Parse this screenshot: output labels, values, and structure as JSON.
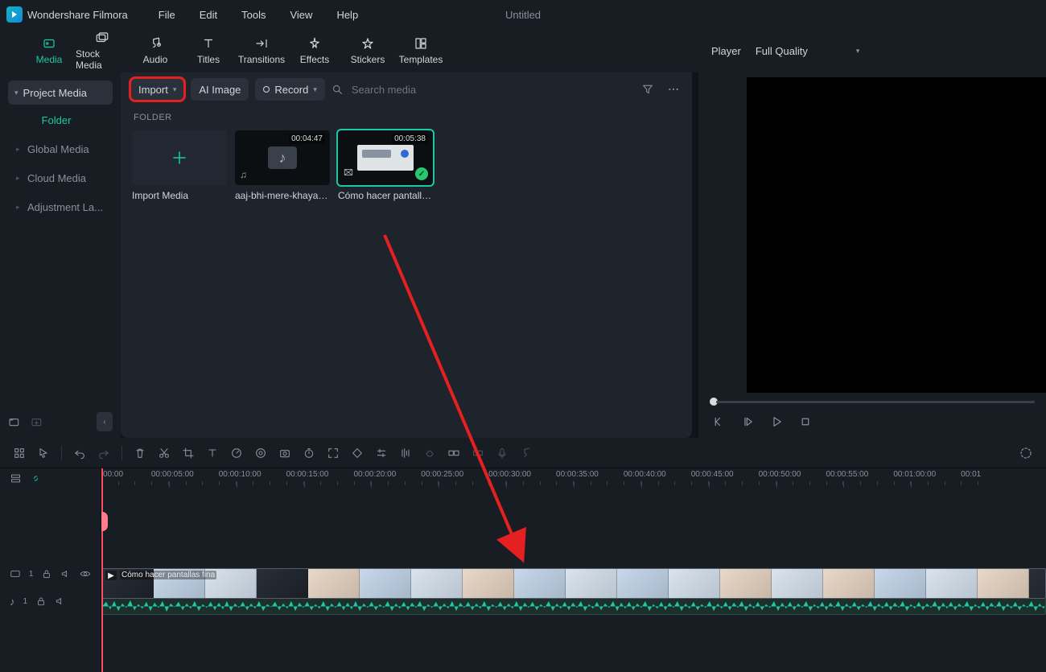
{
  "app": {
    "name": "Wondershare Filmora",
    "doc_title": "Untitled"
  },
  "menu": [
    "File",
    "Edit",
    "Tools",
    "View",
    "Help"
  ],
  "tabs": [
    {
      "label": "Media",
      "active": true
    },
    {
      "label": "Stock Media"
    },
    {
      "label": "Audio"
    },
    {
      "label": "Titles"
    },
    {
      "label": "Transitions"
    },
    {
      "label": "Effects"
    },
    {
      "label": "Stickers"
    },
    {
      "label": "Templates"
    }
  ],
  "sidebar": {
    "header": "Project Media",
    "folder_label": "Folder",
    "items": [
      "Global Media",
      "Cloud Media",
      "Adjustment La..."
    ]
  },
  "mediabar": {
    "import_label": "Import",
    "ai_label": "AI Image",
    "record_label": "Record",
    "search_placeholder": "Search media"
  },
  "folder_header": "FOLDER",
  "thumbs": [
    {
      "caption": "Import Media",
      "kind": "plus"
    },
    {
      "caption": "aaj-bhi-mere-khayalo...",
      "kind": "audio",
      "duration": "00:04:47"
    },
    {
      "caption": "Cómo hacer pantallas ...",
      "kind": "video",
      "duration": "00:05:38",
      "selected": true
    }
  ],
  "player": {
    "label": "Player",
    "quality": "Full Quality"
  },
  "ruler": [
    "00:00",
    "00:00:05:00",
    "00:00:10:00",
    "00:00:15:00",
    "00:00:20:00",
    "00:00:25:00",
    "00:00:30:00",
    "00:00:35:00",
    "00:00:40:00",
    "00:00:45:00",
    "00:00:50:00",
    "00:00:55:00",
    "00:01:00:00",
    "00:01"
  ],
  "clip": {
    "title": "Cómo hacer pantallas fina"
  },
  "tracks": {
    "video_index": "1",
    "audio_index": "1"
  }
}
